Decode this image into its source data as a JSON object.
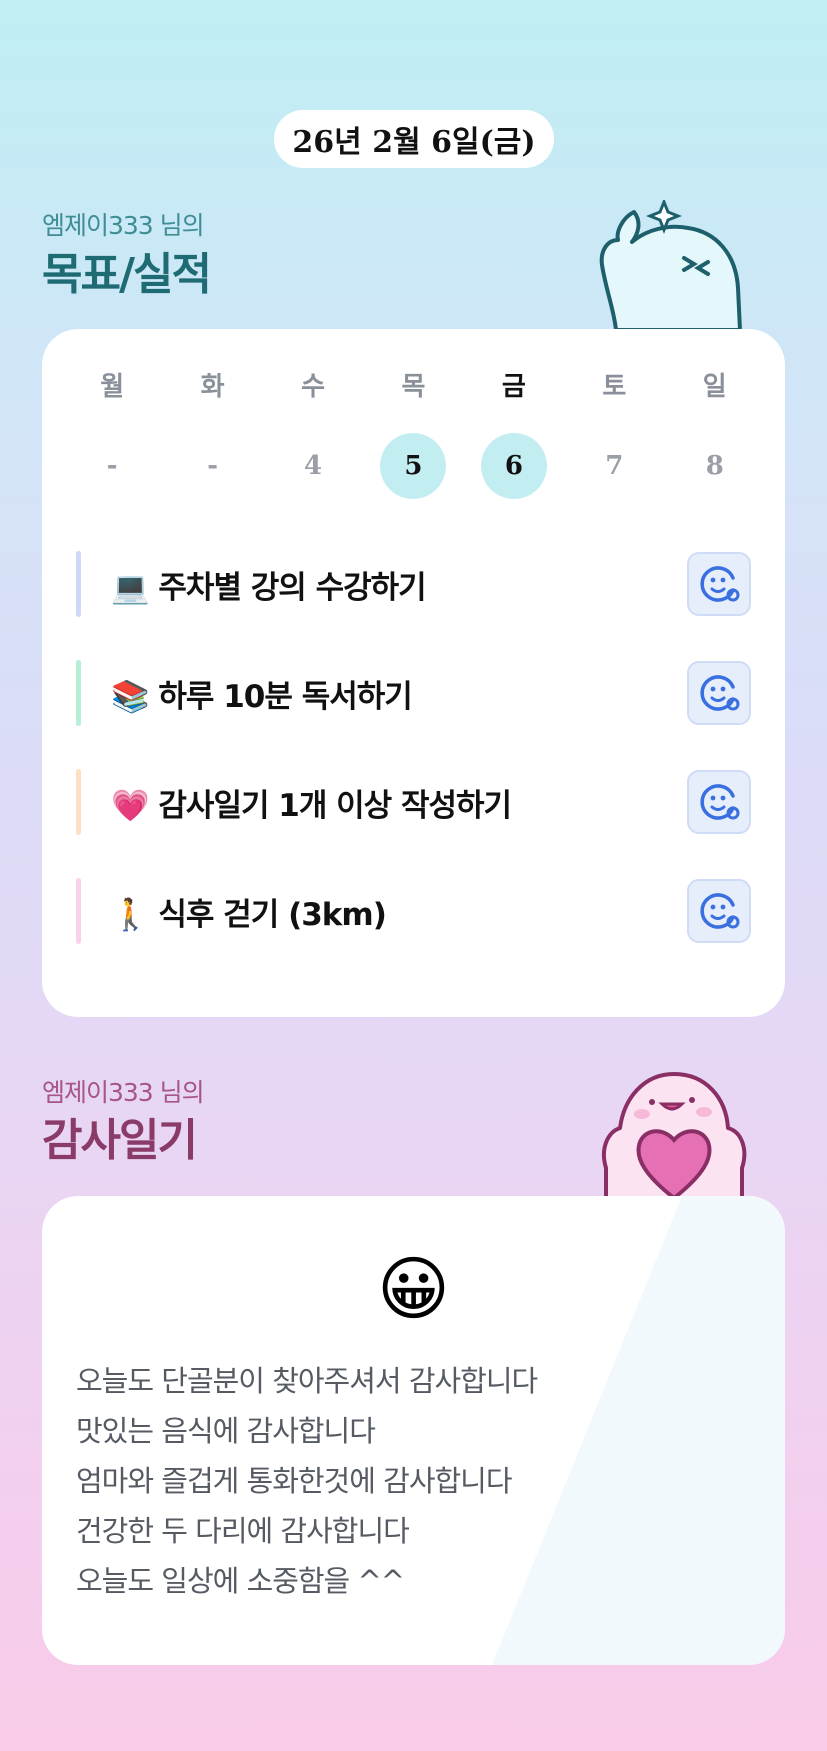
{
  "date": "26년 2월 6일(금)",
  "goals_section": {
    "subtitle": "엠제이333 님의",
    "title": "목표/실적",
    "weekdays": [
      "월",
      "화",
      "수",
      "목",
      "금",
      "토",
      "일"
    ],
    "dates": [
      "-",
      "-",
      "4",
      "5",
      "6",
      "7",
      "8"
    ],
    "items": [
      {
        "emoji": "💻",
        "label": "주차별 강의 수강하기",
        "bar_color": "#cdd8fa"
      },
      {
        "emoji": "📚",
        "label": "하루 10분 독서하기",
        "bar_color": "#b5efd6"
      },
      {
        "emoji": "💗",
        "label": "감사일기 1개 이상 작성하기",
        "bar_color": "#fde0c4"
      },
      {
        "emoji": "🚶",
        "label": "식후 걷기 (3km)",
        "bar_color": "#fad2ec"
      }
    ],
    "action_icon": "smile-face-icon"
  },
  "diary_section": {
    "subtitle": "엠제이333 님의",
    "title": "감사일기",
    "mood_emoji": "😀",
    "lines": [
      "오늘도 단골분이 찾아주셔서 감사합니다",
      "맛있는 음식에 감사합니다",
      "엄마와 즐겁게 통화한것에 감사합니다",
      "건강한 두 다리에 감사합니다",
      "오늘도 일상에 소중함을 ^^"
    ]
  },
  "colors": {
    "goals_title": "#1f6b73",
    "goals_subtitle": "#3e8c94",
    "diary_title": "#8a3b68",
    "diary_subtitle": "#a85489",
    "accent_circle": "#c2eef2",
    "icon_blue": "#3a6fe0"
  }
}
